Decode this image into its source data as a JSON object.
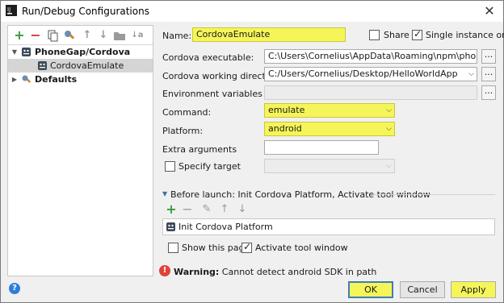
{
  "window": {
    "title": "Run/Debug Configurations",
    "close_glyph": "✕"
  },
  "left_toolbar": {
    "icons": [
      "add-icon",
      "remove-icon",
      "copy-icon",
      "edit-defaults-icon",
      "move-up-icon",
      "move-down-icon",
      "folder-icon",
      "sort-icon"
    ]
  },
  "tree": {
    "group": "PhoneGap/Cordova",
    "item": "CordovaEmulate",
    "defaults": "Defaults"
  },
  "form": {
    "name_label": "Name:",
    "name_value": "CordovaEmulate",
    "share_label": "Share",
    "share_checked": false,
    "single_instance_label": "Single instance only",
    "single_instance_checked": true,
    "executable_label": "Cordova executable:",
    "executable_value": "C:\\Users\\Cornelius\\AppData\\Roaming\\npm\\phonegap.c",
    "working_dir_label": "Cordova working directory:",
    "working_dir_value": "C:/Users/Cornelius/Desktop/HelloWorldApp",
    "env_label": "Environment variables",
    "env_value": "",
    "command_label": "Command:",
    "command_value": "emulate",
    "platform_label": "Platform:",
    "platform_value": "android",
    "extra_label": "Extra arguments",
    "extra_value": "",
    "target_label": "Specify target",
    "target_checked": false,
    "browse_glyph": "..."
  },
  "before_launch": {
    "header": "Before launch: Init Cordova Platform, Activate tool window",
    "tasks": [
      "Init Cordova Platform"
    ],
    "show_page_label": "Show this page",
    "show_page_checked": false,
    "activate_label": "Activate tool window",
    "activate_checked": true
  },
  "warning": {
    "bold": "Warning:",
    "text": "Cannot detect android SDK in path"
  },
  "buttons": {
    "ok": "OK",
    "cancel": "Cancel",
    "apply": "Apply"
  },
  "colors": {
    "highlight": "#f5f55a",
    "selected_row": "#d5d5d5",
    "help": "#2f7ed8",
    "error": "#e0433b"
  }
}
